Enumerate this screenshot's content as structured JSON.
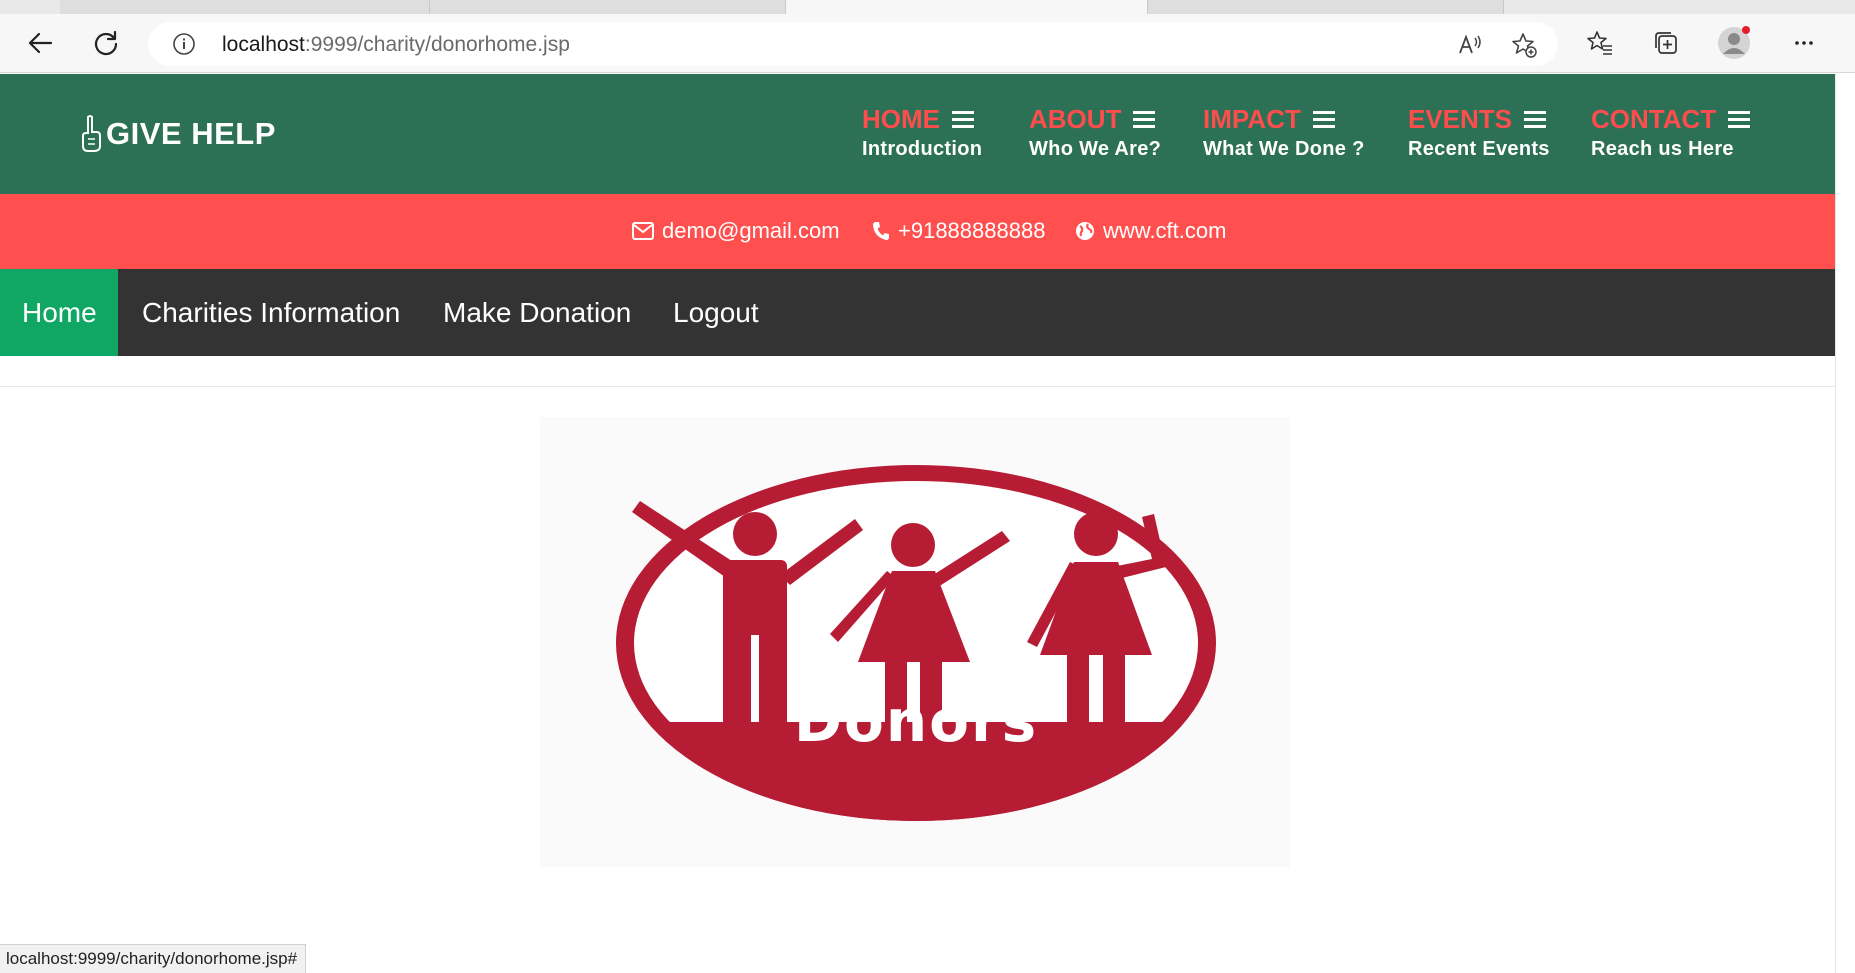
{
  "browser": {
    "url_host": "localhost",
    "url_rest": ":9999/charity/donorhome.jsp",
    "status_url": "localhost:9999/charity/donorhome.jsp#"
  },
  "brand": {
    "name": "GIVE HELP",
    "colors": {
      "header": "#2c7055",
      "accent": "#ff4d4d",
      "infobar": "#ff4f4f",
      "nav": "#333333",
      "nav_active": "#0fa763",
      "logo_red": "#b71c35"
    }
  },
  "main_nav": [
    {
      "title": "HOME",
      "subtitle": "Introduction"
    },
    {
      "title": "ABOUT",
      "subtitle": "Who We Are?"
    },
    {
      "title": "IMPACT",
      "subtitle": "What We Done ?"
    },
    {
      "title": "EVENTS",
      "subtitle": "Recent Events"
    },
    {
      "title": "CONTACT",
      "subtitle": "Reach us Here"
    }
  ],
  "contact": {
    "email": "demo@gmail.com",
    "phone": "+91888888888",
    "website": "www.cft.com"
  },
  "secondary_nav": [
    {
      "label": "Home",
      "active": true
    },
    {
      "label": "Charities Information",
      "active": false
    },
    {
      "label": "Make Donation",
      "active": false
    },
    {
      "label": "Logout",
      "active": false
    }
  ],
  "content": {
    "banner_text": "Donors"
  }
}
